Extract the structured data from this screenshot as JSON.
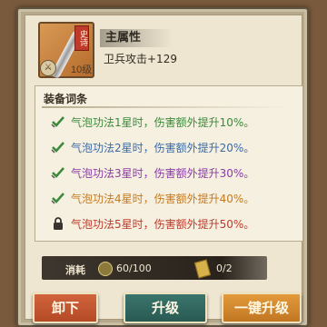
{
  "item": {
    "rarity": "史诗",
    "level_badge": "⚔",
    "level_text": "10级"
  },
  "attribute": {
    "header": "主属性",
    "value": "卫兵攻击+129"
  },
  "affix_section": {
    "title": "装备词条",
    "items": [
      {
        "text": "气泡功法1星时，伤害额外提升10%。",
        "color": "#3a8a3a",
        "status": "unlocked"
      },
      {
        "text": "气泡功法2星时，伤害额外提升20%。",
        "color": "#3a6aa8",
        "status": "unlocked"
      },
      {
        "text": "气泡功法3星时，伤害额外提升30%。",
        "color": "#8a3aa8",
        "status": "unlocked"
      },
      {
        "text": "气泡功法4星时，伤害额外提升40%。",
        "color": "#c57a20",
        "status": "unlocked"
      },
      {
        "text": "气泡功法5星时，伤害额外提升50%。",
        "color": "#c0392b",
        "status": "locked"
      }
    ]
  },
  "cost": {
    "label": "消耗",
    "coins": "60/100",
    "tickets": "0/2"
  },
  "buttons": {
    "unequip": "卸下",
    "upgrade": "升级",
    "one_click_upgrade": "一键升级"
  }
}
